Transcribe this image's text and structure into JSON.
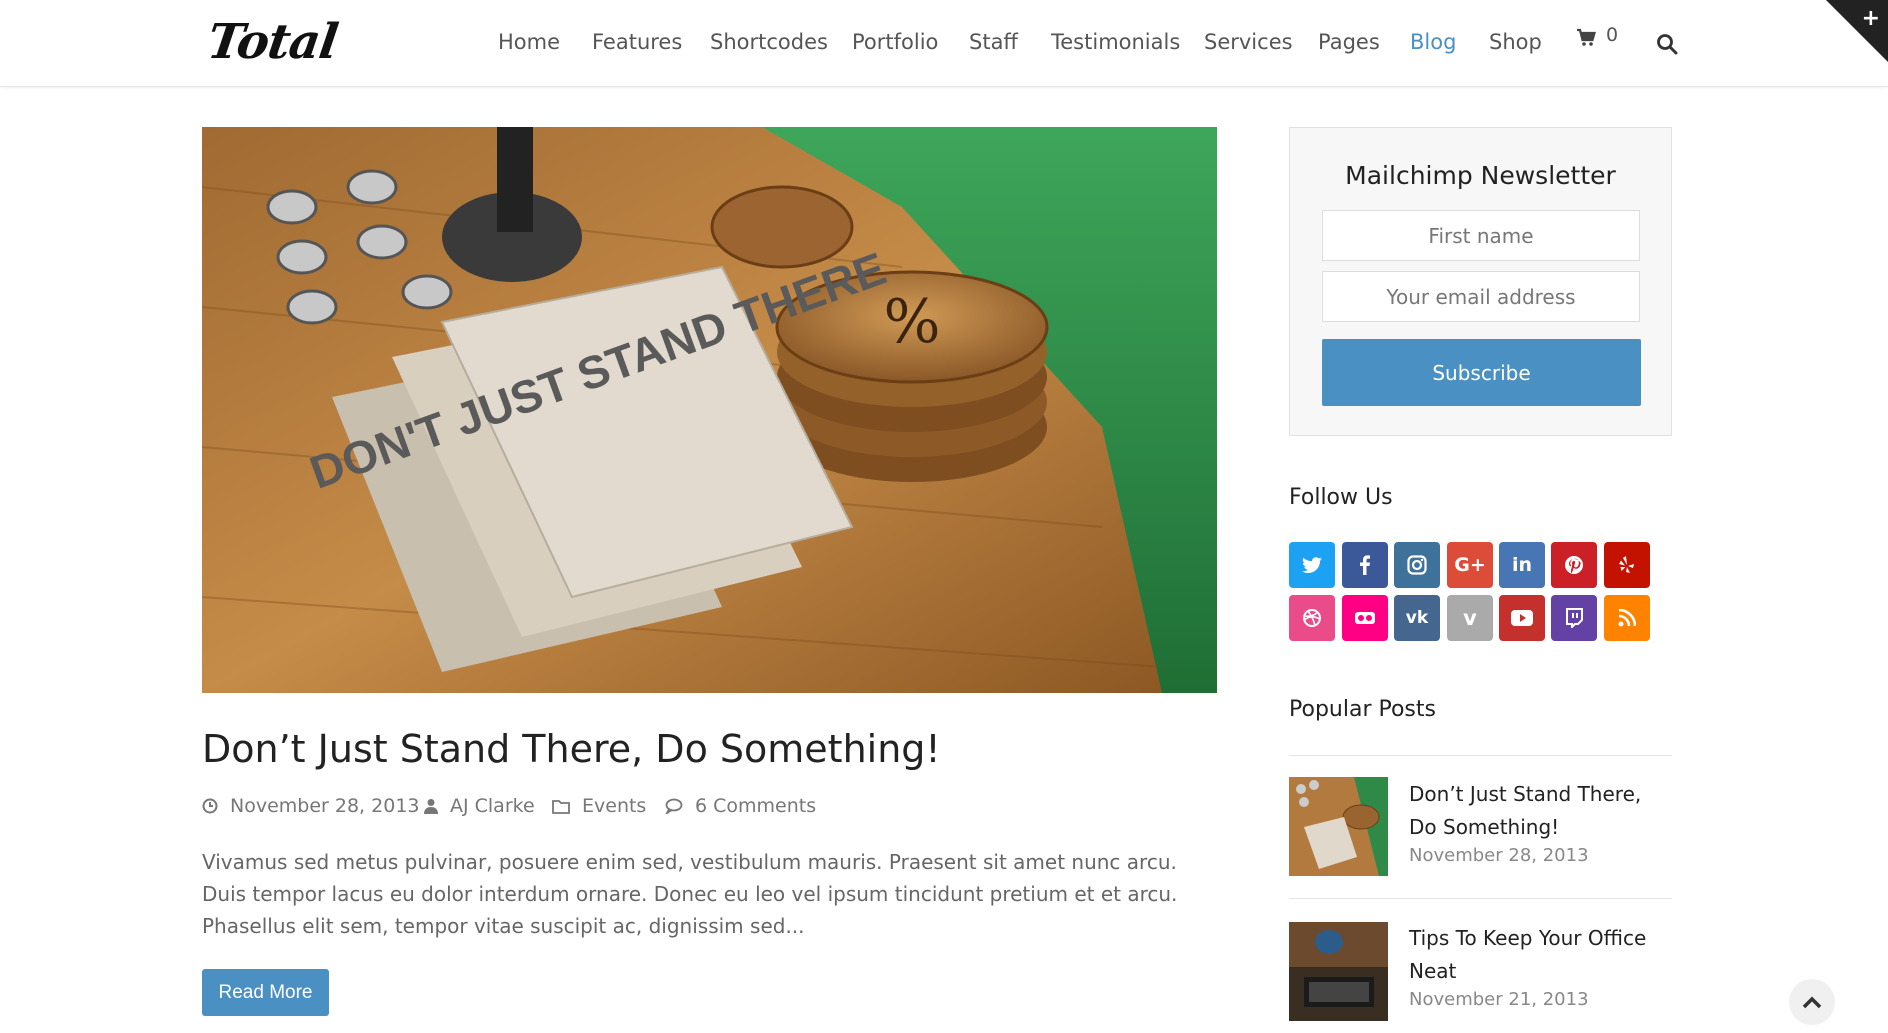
{
  "header": {
    "logo": "Total",
    "nav": [
      {
        "label": "Home"
      },
      {
        "label": "Features"
      },
      {
        "label": "Shortcodes"
      },
      {
        "label": "Portfolio"
      },
      {
        "label": "Staff"
      },
      {
        "label": "Testimonials"
      },
      {
        "label": "Services"
      },
      {
        "label": "Pages"
      },
      {
        "label": "Blog",
        "active": true
      },
      {
        "label": "Shop"
      }
    ],
    "cart_count": "0",
    "accent_color": "#4a90c2"
  },
  "post": {
    "title": "Don’t Just Stand There, Do Something!",
    "date": "November 28, 2013",
    "author": "AJ Clarke",
    "category": "Events",
    "comments": "6 Comments",
    "excerpt": "Vivamus sed metus pulvinar, posuere enim sed, vestibulum mauris. Praesent sit amet nunc arcu. Duis tempor lacus eu dolor interdum ornare. Donec eu leo vel ipsum tincidunt pretium et et arcu. Phasellus elit sem, tempor vitae suscipit ac, dignissim sed...",
    "read_more": "Read More",
    "image_text": "DON'T JUST STAND THERE"
  },
  "sidebar": {
    "newsletter": {
      "title": "Mailchimp Newsletter",
      "first_name_placeholder": "First name",
      "email_placeholder": "Your email address",
      "subscribe_label": "Subscribe"
    },
    "follow": {
      "title": "Follow Us",
      "icons": [
        {
          "name": "twitter-icon",
          "color": "#1da1f2"
        },
        {
          "name": "facebook-icon",
          "color": "#3b5998"
        },
        {
          "name": "instagram-icon",
          "color": "#3f729b"
        },
        {
          "name": "google-plus-icon",
          "color": "#dd4b39"
        },
        {
          "name": "linkedin-icon",
          "color": "#4875b4"
        },
        {
          "name": "pinterest-icon",
          "color": "#cb2027"
        },
        {
          "name": "yelp-icon",
          "color": "#c41200"
        },
        {
          "name": "dribbble-icon",
          "color": "#ea4c89"
        },
        {
          "name": "flickr-icon",
          "color": "#ff0084"
        },
        {
          "name": "vk-icon",
          "color": "#45668e"
        },
        {
          "name": "vimeo-icon",
          "color": "#aaaaaa"
        },
        {
          "name": "youtube-icon",
          "color": "#c4302b"
        },
        {
          "name": "twitch-icon",
          "color": "#6441a5"
        },
        {
          "name": "rss-icon",
          "color": "#ff8300"
        }
      ]
    },
    "popular": {
      "title": "Popular Posts",
      "posts": [
        {
          "title": "Don’t Just Stand There, Do Something!",
          "date": "November 28, 2013"
        },
        {
          "title": "Tips To Keep Your Office Neat",
          "date": "November 21, 2013"
        }
      ]
    }
  }
}
